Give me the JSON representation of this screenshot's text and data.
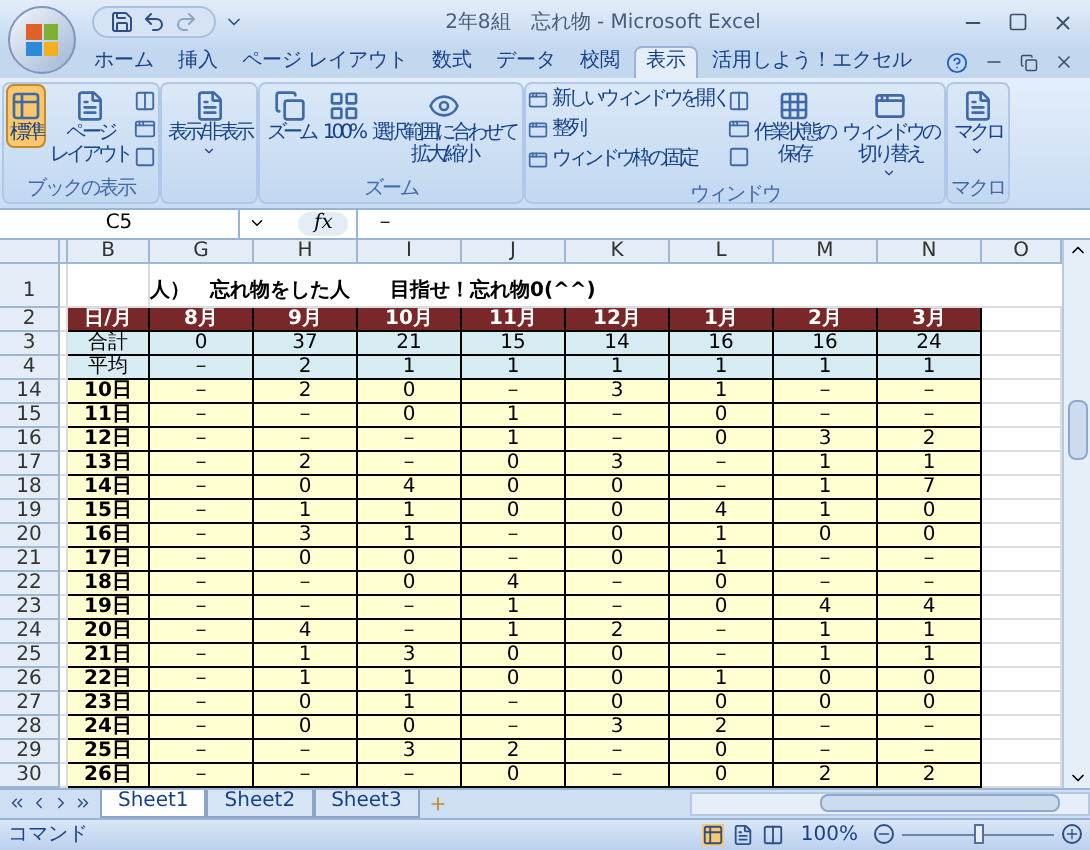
{
  "window": {
    "title": "2年8組　忘れ物 - Microsoft Excel"
  },
  "ribbon_tabs": [
    {
      "label": "ホーム",
      "selected": false
    },
    {
      "label": "挿入",
      "selected": false
    },
    {
      "label": "ページ レイアウト",
      "selected": false
    },
    {
      "label": "数式",
      "selected": false
    },
    {
      "label": "データ",
      "selected": false
    },
    {
      "label": "校閲",
      "selected": false
    },
    {
      "label": "表示",
      "selected": true
    },
    {
      "label": "活用しよう！エクセル",
      "selected": false
    }
  ],
  "ribbon_groups": [
    {
      "label": "ブックの表示",
      "items": [
        {
          "kind": "large",
          "lines": [
            "標準"
          ],
          "selected": true
        },
        {
          "kind": "large",
          "lines": [
            "ページ",
            "レイアウト"
          ],
          "selected": false
        },
        {
          "kind": "icon_column"
        }
      ]
    },
    {
      "items": [
        {
          "kind": "dropdown",
          "lines": [
            "表示/非表示"
          ]
        }
      ]
    },
    {
      "label": "ズーム",
      "items": [
        {
          "kind": "large",
          "lines": [
            "ズーム"
          ]
        },
        {
          "kind": "large",
          "lines": [
            "100%"
          ]
        },
        {
          "kind": "large",
          "lines": [
            "選択範囲に合わせて",
            "拡大/縮小"
          ]
        }
      ]
    },
    {
      "label": "ウィンドウ",
      "items": [
        {
          "kind": "small",
          "lines": [
            "新しいウィンドウを開く"
          ]
        },
        {
          "kind": "small",
          "lines": [
            "整列"
          ]
        },
        {
          "kind": "small",
          "lines": [
            "ウィンドウ枠の固定"
          ]
        },
        {
          "kind": "icon_column"
        },
        {
          "kind": "large",
          "lines": [
            "作業状態の",
            "保存"
          ]
        },
        {
          "kind": "dropdown",
          "lines": [
            "ウィンドウの",
            "切り替え"
          ]
        }
      ]
    },
    {
      "label": "マクロ",
      "items": [
        {
          "kind": "dropdown",
          "lines": [
            "マクロ"
          ]
        }
      ]
    }
  ],
  "formula_bar": {
    "name_box": "C5",
    "fx": "fx",
    "formula": "－"
  },
  "sheet": {
    "columns": [
      "B",
      "G",
      "H",
      "I",
      "J",
      "K",
      "L",
      "M",
      "N",
      "O"
    ],
    "title_row": {
      "number": "1",
      "text": "人）　忘れ物をした人　　目指せ！忘れ物0(^^)"
    },
    "rows": [
      {
        "number": "2",
        "kind": "header",
        "cells": [
          "日/月",
          "8月",
          "9月",
          "10月",
          "11月",
          "12月",
          "1月",
          "2月",
          "3月"
        ]
      },
      {
        "number": "3",
        "kind": "summary",
        "cells": [
          "合計",
          "0",
          "37",
          "21",
          "15",
          "14",
          "16",
          "16",
          "24"
        ]
      },
      {
        "number": "4",
        "kind": "summary",
        "cells": [
          "平均",
          "－",
          "2",
          "1",
          "1",
          "1",
          "1",
          "1",
          "1"
        ]
      },
      {
        "number": "14",
        "kind": "day",
        "cells": [
          "10日",
          "－",
          "2",
          "0",
          "－",
          "3",
          "1",
          "－",
          "－"
        ]
      },
      {
        "number": "15",
        "kind": "day",
        "cells": [
          "11日",
          "－",
          "－",
          "0",
          "1",
          "－",
          "0",
          "－",
          "－"
        ]
      },
      {
        "number": "16",
        "kind": "day",
        "cells": [
          "12日",
          "－",
          "－",
          "－",
          "1",
          "－",
          "0",
          "3",
          "2"
        ]
      },
      {
        "number": "17",
        "kind": "day",
        "cells": [
          "13日",
          "－",
          "2",
          "－",
          "0",
          "3",
          "－",
          "1",
          "1"
        ]
      },
      {
        "number": "18",
        "kind": "day",
        "cells": [
          "14日",
          "－",
          "0",
          "4",
          "0",
          "0",
          "－",
          "1",
          "7"
        ]
      },
      {
        "number": "19",
        "kind": "day",
        "cells": [
          "15日",
          "－",
          "1",
          "1",
          "0",
          "0",
          "4",
          "1",
          "0"
        ]
      },
      {
        "number": "20",
        "kind": "day",
        "cells": [
          "16日",
          "－",
          "3",
          "1",
          "－",
          "0",
          "1",
          "0",
          "0"
        ]
      },
      {
        "number": "21",
        "kind": "day",
        "cells": [
          "17日",
          "－",
          "0",
          "0",
          "－",
          "0",
          "1",
          "－",
          "－"
        ]
      },
      {
        "number": "22",
        "kind": "day",
        "cells": [
          "18日",
          "－",
          "－",
          "0",
          "4",
          "－",
          "0",
          "－",
          "－"
        ]
      },
      {
        "number": "23",
        "kind": "day",
        "cells": [
          "19日",
          "－",
          "－",
          "－",
          "1",
          "－",
          "0",
          "4",
          "4"
        ]
      },
      {
        "number": "24",
        "kind": "day",
        "cells": [
          "20日",
          "－",
          "4",
          "－",
          "1",
          "2",
          "－",
          "1",
          "1"
        ]
      },
      {
        "number": "25",
        "kind": "day",
        "cells": [
          "21日",
          "－",
          "1",
          "3",
          "0",
          "0",
          "－",
          "1",
          "1"
        ]
      },
      {
        "number": "26",
        "kind": "day",
        "cells": [
          "22日",
          "－",
          "1",
          "1",
          "0",
          "0",
          "1",
          "0",
          "0"
        ]
      },
      {
        "number": "27",
        "kind": "day",
        "cells": [
          "23日",
          "－",
          "0",
          "1",
          "－",
          "0",
          "0",
          "0",
          "0"
        ]
      },
      {
        "number": "28",
        "kind": "day",
        "cells": [
          "24日",
          "－",
          "0",
          "0",
          "－",
          "3",
          "2",
          "－",
          "－"
        ]
      },
      {
        "number": "29",
        "kind": "day",
        "cells": [
          "25日",
          "－",
          "－",
          "3",
          "2",
          "－",
          "0",
          "－",
          "－"
        ]
      },
      {
        "number": "30",
        "kind": "day",
        "cells": [
          "26日",
          "－",
          "－",
          "－",
          "0",
          "－",
          "0",
          "2",
          "2"
        ]
      }
    ]
  },
  "sheet_tabs": [
    {
      "label": "Sheet1",
      "selected": true
    },
    {
      "label": "Sheet2",
      "selected": false
    },
    {
      "label": "Sheet3",
      "selected": false
    }
  ],
  "status_bar": {
    "mode": "コマンド",
    "zoom": "100%",
    "zoom_slider": {
      "level": 0.5
    }
  }
}
